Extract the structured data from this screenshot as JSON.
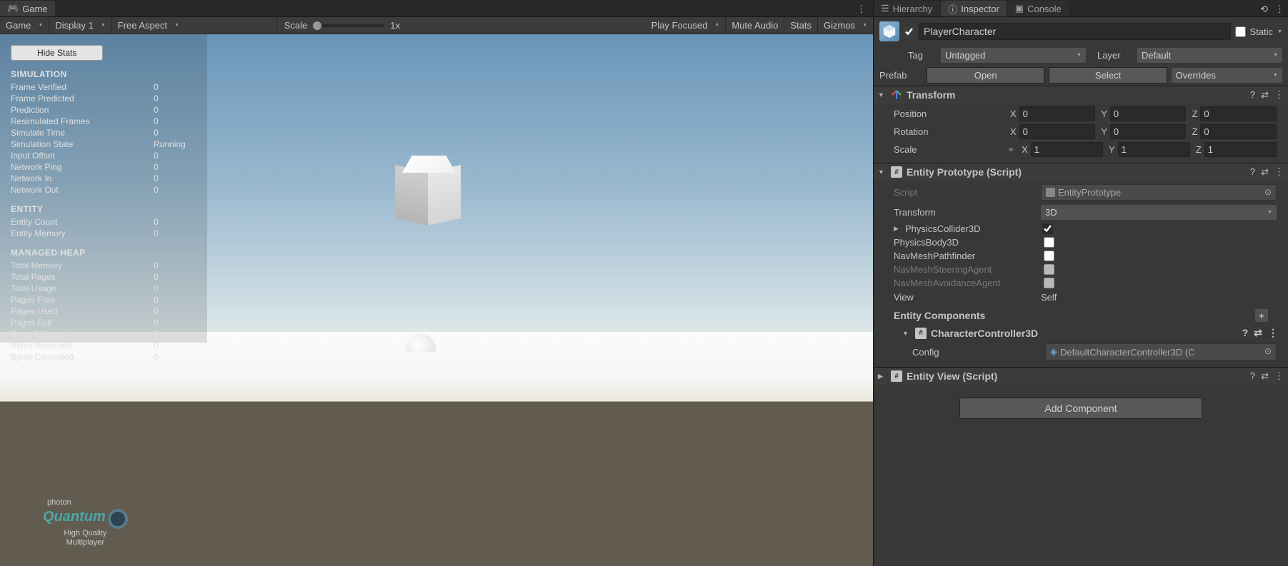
{
  "left_tabs": {
    "game": "Game"
  },
  "toolbar": {
    "mode": "Game",
    "display": "Display 1",
    "aspect": "Free Aspect",
    "scale_label": "Scale",
    "scale_value": "1x",
    "focus": "Play Focused",
    "mute": "Mute Audio",
    "stats": "Stats",
    "gizmos": "Gizmos"
  },
  "stats": {
    "hide_btn": "Hide Stats",
    "simulation": {
      "header": "SIMULATION",
      "rows": [
        {
          "k": "Frame Verified",
          "v": "0"
        },
        {
          "k": "Frame Predicted",
          "v": "0"
        },
        {
          "k": "Prediction",
          "v": "0"
        },
        {
          "k": "Resimulated Frames",
          "v": "0"
        },
        {
          "k": "Simulate Time",
          "v": "0"
        },
        {
          "k": "Simulation State",
          "v": "Running"
        },
        {
          "k": "Input Offset",
          "v": "0"
        },
        {
          "k": "Network Ping",
          "v": "0"
        },
        {
          "k": "Network In",
          "v": "0"
        },
        {
          "k": "Network Out",
          "v": "0"
        }
      ]
    },
    "entity": {
      "header": "ENTITY",
      "rows": [
        {
          "k": "Entity Count",
          "v": "0"
        },
        {
          "k": "Entity Memory",
          "v": "0"
        }
      ]
    },
    "heap": {
      "header": "MANAGED HEAP",
      "rows": [
        {
          "k": "Total Memory",
          "v": "0"
        },
        {
          "k": "Total Pages",
          "v": "0"
        },
        {
          "k": "Total Usage",
          "v": "0"
        },
        {
          "k": "Pages Free",
          "v": "0"
        },
        {
          "k": "Pages Used",
          "v": "0"
        },
        {
          "k": "Pages Full",
          "v": "0"
        },
        {
          "k": "Bytes Allocated",
          "v": "0"
        },
        {
          "k": "Bytes Reserved",
          "v": "0"
        },
        {
          "k": "Bytes Commited",
          "v": "0"
        }
      ]
    }
  },
  "photon": {
    "top": "photon",
    "name": "Quantum",
    "t1": "High Quality",
    "t2": "Multiplayer"
  },
  "right_tabs": {
    "hierarchy": "Hierarchy",
    "inspector": "Inspector",
    "console": "Console"
  },
  "inspector": {
    "name": "PlayerCharacter",
    "static": "Static",
    "tag_label": "Tag",
    "tag_value": "Untagged",
    "layer_label": "Layer",
    "layer_value": "Default",
    "prefab_label": "Prefab",
    "open_btn": "Open",
    "select_btn": "Select",
    "overrides_btn": "Overrides",
    "transform": {
      "title": "Transform",
      "position": "Position",
      "rotation": "Rotation",
      "scale": "Scale",
      "px": "0",
      "py": "0",
      "pz": "0",
      "rx": "0",
      "ry": "0",
      "rz": "0",
      "sx": "1",
      "sy": "1",
      "sz": "1"
    },
    "entity_proto": {
      "title": "Entity Prototype (Script)",
      "script_label": "Script",
      "script_value": "EntityPrototype",
      "transform_label": "Transform",
      "transform_value": "3D",
      "physcol": "PhysicsCollider3D",
      "physbody": "PhysicsBody3D",
      "navpath": "NavMeshPathfinder",
      "navsteer": "NavMeshSteeringAgent",
      "navavoid": "NavMeshAvoidanceAgent",
      "view_label": "View",
      "view_value": "Self",
      "components_header": "Entity Components",
      "charctrl": "CharacterController3D",
      "config_label": "Config",
      "config_value": "DefaultCharacterController3D (C"
    },
    "entity_view": {
      "title": "Entity View (Script)"
    },
    "add_component": "Add Component"
  }
}
